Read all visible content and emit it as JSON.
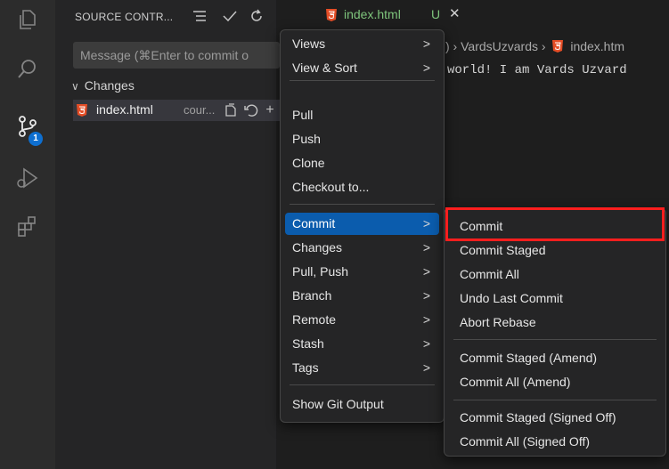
{
  "sidebar": {
    "title": "SOURCE CONTR...",
    "more_label": "···",
    "message_placeholder": "Message (⌘Enter to commit o",
    "changes_label": "Changes",
    "changes_chevron": "∨",
    "file": {
      "name": "index.html",
      "dir": "cour...",
      "add_label": "+"
    }
  },
  "activity": {
    "badge": "1"
  },
  "tab": {
    "name": "index.html",
    "status": "U",
    "close": "✕"
  },
  "editor": {
    "breadcrumb_prefix": ") › VardsUzvards ›",
    "breadcrumb_file": "index.htm",
    "code": "world! I am Vards Uzvard"
  },
  "menu": {
    "views": "Views",
    "view_sort": "View & Sort",
    "pull": "Pull",
    "push": "Push",
    "clone": "Clone",
    "checkout": "Checkout to...",
    "commit": "Commit",
    "changes": "Changes",
    "pull_push": "Pull, Push",
    "branch": "Branch",
    "remote": "Remote",
    "stash": "Stash",
    "tags": "Tags",
    "show_git_output": "Show Git Output",
    "arrow": ">"
  },
  "submenu": {
    "commit": "Commit",
    "commit_staged": "Commit Staged",
    "commit_all": "Commit All",
    "undo_last_commit": "Undo Last Commit",
    "abort_rebase": "Abort Rebase",
    "commit_staged_amend": "Commit Staged (Amend)",
    "commit_all_amend": "Commit All (Amend)",
    "commit_staged_signed": "Commit Staged (Signed Off)",
    "commit_all_signed": "Commit All (Signed Off)"
  },
  "colors": {
    "accent": "#0b5cad",
    "highlight": "#ff1e1e",
    "untracked": "#7ec47c",
    "html_icon": "#e44d26"
  }
}
